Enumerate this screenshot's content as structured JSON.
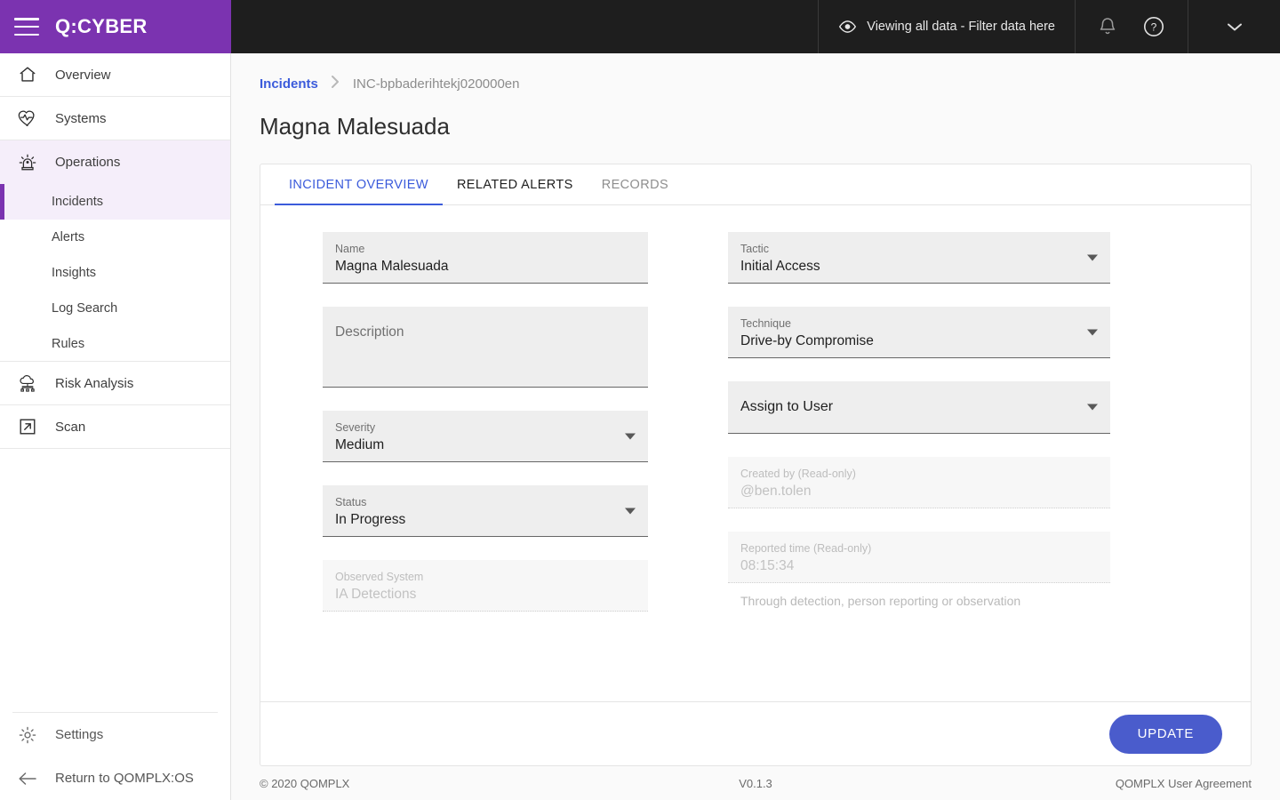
{
  "brand": {
    "name": "Q:CYBER",
    "menu_icon": "hamburger-icon"
  },
  "topbar": {
    "view_filter_label": "Viewing all data - Filter data here",
    "eye_icon": "eye-icon",
    "bell_icon": "bell-icon",
    "help_icon": "help-circle-icon",
    "account_caret_icon": "chevron-down-icon"
  },
  "sidebar": {
    "items": [
      {
        "label": "Overview",
        "icon": "home-icon"
      },
      {
        "label": "Systems",
        "icon": "heartbeat-shield-icon"
      },
      {
        "label": "Operations",
        "icon": "siren-icon"
      }
    ],
    "sub_items": [
      {
        "label": "Incidents",
        "active": true
      },
      {
        "label": "Alerts",
        "active": false
      },
      {
        "label": "Insights",
        "active": false
      },
      {
        "label": "Log Search",
        "active": false
      },
      {
        "label": "Rules",
        "active": false
      }
    ],
    "items_after": [
      {
        "label": "Risk Analysis",
        "icon": "cloud-network-icon"
      },
      {
        "label": "Scan",
        "icon": "external-arrow-box-icon"
      }
    ],
    "bottom_items": [
      {
        "label": "Settings",
        "icon": "gear-icon"
      },
      {
        "label": "Return to QOMPLX:OS",
        "icon": "arrow-left-icon"
      }
    ]
  },
  "breadcrumb": {
    "parent": "Incidents",
    "separator_icon": "chevron-right-icon",
    "current": "INC-bpbaderihtekj020000en"
  },
  "page": {
    "title": "Magna Malesuada"
  },
  "tabs": [
    {
      "label": "INCIDENT OVERVIEW",
      "state": "active"
    },
    {
      "label": "RELATED ALERTS",
      "state": "dark"
    },
    {
      "label": "RECORDS",
      "state": "grey"
    }
  ],
  "form": {
    "left": {
      "name": {
        "label": "Name",
        "value": "Magna Malesuada"
      },
      "description": {
        "placeholder": "Description",
        "value": ""
      },
      "severity": {
        "label": "Severity",
        "value": "Medium",
        "caret_icon": "caret-down-icon"
      },
      "status": {
        "label": "Status",
        "value": "In Progress",
        "caret_icon": "caret-down-icon"
      },
      "observed_system": {
        "label": "Observed System",
        "value": "IA Detections",
        "readonly": true
      }
    },
    "right": {
      "tactic": {
        "label": "Tactic",
        "value": "Initial Access",
        "caret_icon": "caret-down-icon"
      },
      "technique": {
        "label": "Technique",
        "value": "Drive-by Compromise",
        "caret_icon": "caret-down-icon"
      },
      "assign_to_user": {
        "placeholder": "Assign to User",
        "caret_icon": "caret-down-icon"
      },
      "created_by": {
        "label": "Created by (Read-only)",
        "value": "@ben.tolen",
        "readonly": true
      },
      "reported_time": {
        "label": "Reported time (Read-only)",
        "value": "08:15:34",
        "readonly": true
      },
      "reported_helper": "Through detection, person reporting or observation"
    }
  },
  "actions": {
    "update_label": "UPDATE"
  },
  "footer": {
    "copyright": "© 2020 QOMPLX",
    "version": "V0.1.3",
    "agreement": "QOMPLX User Agreement"
  },
  "colors": {
    "brand_purple": "#7B33B0",
    "topbar_dark": "#1e1e1e",
    "accent_blue": "#3b5bdb",
    "button_blue": "#4a5ccc",
    "active_nav_bg": "#f5eefa"
  }
}
